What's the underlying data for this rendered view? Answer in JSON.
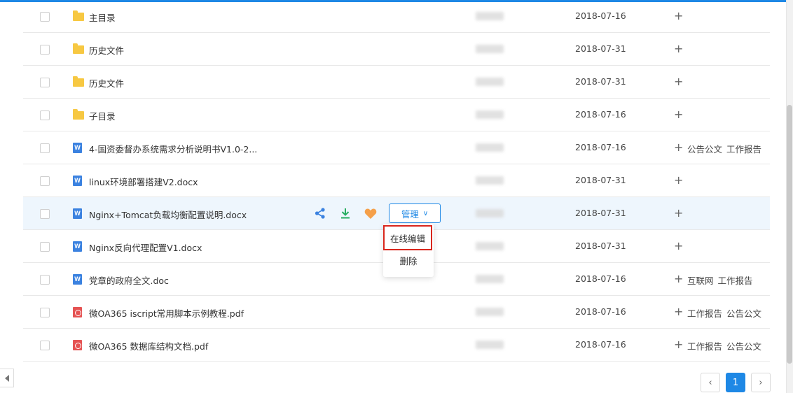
{
  "files": [
    {
      "type": "folder",
      "name": "主目录",
      "date": "2018-07-16",
      "tags": []
    },
    {
      "type": "folder",
      "name": "历史文件",
      "date": "2018-07-31",
      "tags": []
    },
    {
      "type": "folder",
      "name": "历史文件",
      "date": "2018-07-31",
      "tags": []
    },
    {
      "type": "folder",
      "name": "子目录",
      "date": "2018-07-16",
      "tags": []
    },
    {
      "type": "word",
      "name": "4-国资委督办系统需求分析说明书V1.0-2...",
      "date": "2018-07-16",
      "tags": [
        "公告公文",
        "工作报告"
      ]
    },
    {
      "type": "word",
      "name": "linux环境部署搭建V2.docx",
      "date": "2018-07-31",
      "tags": []
    },
    {
      "type": "word",
      "name": "Nginx+Tomcat负载均衡配置说明.docx",
      "date": "2018-07-31",
      "tags": []
    },
    {
      "type": "word",
      "name": "Nginx反向代理配置V1.docx",
      "date": "2018-07-31",
      "tags": []
    },
    {
      "type": "word",
      "name": "党章的政府全文.doc",
      "date": "2018-07-16",
      "tags": [
        "互联网",
        "工作报告"
      ]
    },
    {
      "type": "pdf",
      "name": "微OA365 iscript常用脚本示例教程.pdf",
      "date": "2018-07-16",
      "tags": [
        "工作报告",
        "公告公文"
      ]
    },
    {
      "type": "pdf",
      "name": "微OA365 数据库结构文档.pdf",
      "date": "2018-07-16",
      "tags": [
        "工作报告",
        "公告公文"
      ]
    }
  ],
  "add_tag_symbol": "+",
  "word_icon_letter": "W",
  "hover_row_index": 6,
  "actions": {
    "manage_label": "管理",
    "chevron": "∨"
  },
  "dropdown": {
    "edit_online": "在线编辑",
    "delete": "删除"
  },
  "pagination": {
    "prev": "‹",
    "current": "1",
    "next": "›"
  },
  "colors": {
    "accent": "#1e88e5",
    "folder": "#f7c842",
    "word": "#3b82e0",
    "pdf": "#e55353",
    "download_icon": "#27ae60",
    "favorite_icon": "#f5a04a",
    "highlight_border": "#d9261c"
  },
  "icons": {
    "share": "share-icon",
    "download": "download-icon",
    "favorite": "heart-icon",
    "collapse": "triangle-left-icon"
  }
}
